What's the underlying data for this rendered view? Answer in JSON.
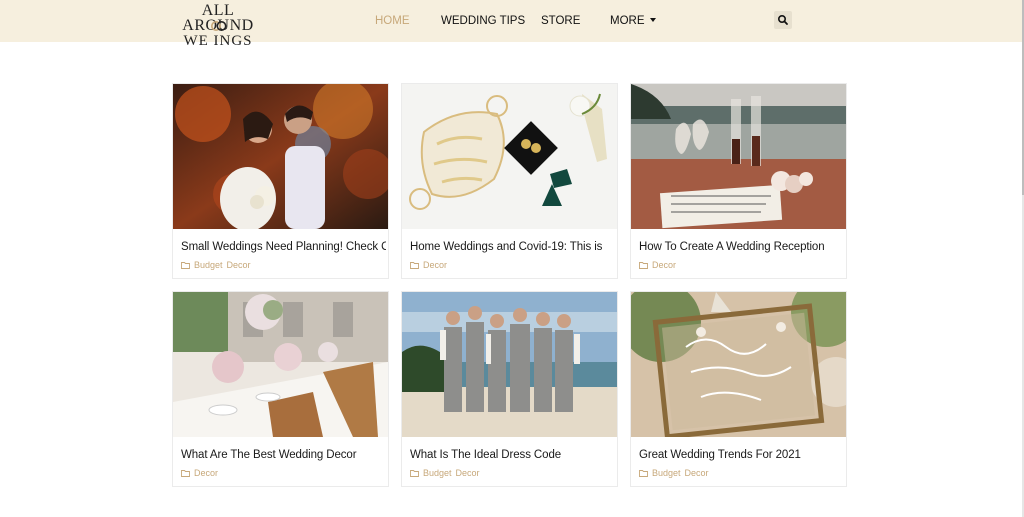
{
  "brand": {
    "line1": "ALL AROUND",
    "line2": "WE  INGS"
  },
  "nav": {
    "items": [
      {
        "label": "HOME",
        "active": true
      },
      {
        "label": "WEDDING TIPS",
        "active": false
      },
      {
        "label": "STORE",
        "active": false
      },
      {
        "label": "MORE",
        "active": false
      }
    ]
  },
  "colors": {
    "header_bg": "#f6efde",
    "accent": "#c7a87a",
    "text": "#1a1a1a"
  },
  "icons": {
    "search": "search-icon",
    "folder": "folder-icon",
    "dropdown": "caret-down-icon"
  },
  "posts": [
    {
      "title": "Small Weddings Need Planning! Check Out",
      "categories": [
        "Budget",
        "Decor"
      ],
      "image": "couple-autumn-photo"
    },
    {
      "title": "Home Weddings and Covid-19: This is",
      "categories": [
        "Decor"
      ],
      "image": "mask-earrings-boutonniere-photo"
    },
    {
      "title": "How To Create A Wedding Reception",
      "categories": [
        "Decor"
      ],
      "image": "beach-table-glasses-photo"
    },
    {
      "title": "What Are The Best Wedding Decor",
      "categories": [
        "Decor"
      ],
      "image": "reception-tables-photo"
    },
    {
      "title": "What Is The Ideal Dress Code",
      "categories": [
        "Budget",
        "Decor"
      ],
      "image": "groomsmen-beach-photo"
    },
    {
      "title": "Great Wedding Trends For 2021",
      "categories": [
        "Budget",
        "Decor"
      ],
      "image": "welcome-sign-frame-photo"
    }
  ]
}
